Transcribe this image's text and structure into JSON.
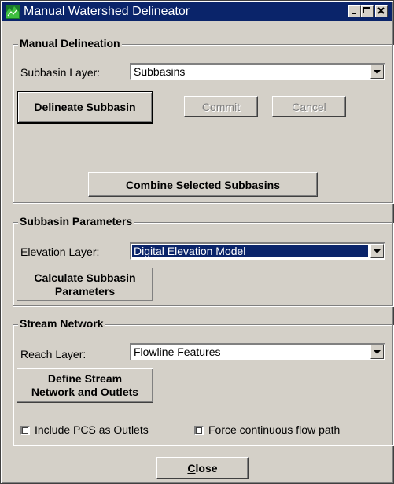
{
  "window": {
    "title": "Manual Watershed Delineator"
  },
  "manual_delineation": {
    "legend": "Manual Delineation",
    "subbasin_layer_label": "Subbasin Layer:",
    "subbasin_layer_value": "Subbasins",
    "delineate_label": "Delineate Subbasin",
    "commit_label": "Commit",
    "cancel_label": "Cancel",
    "combine_label": "Combine Selected Subbasins"
  },
  "subbasin_parameters": {
    "legend": "Subbasin Parameters",
    "elevation_label": "Elevation Layer:",
    "elevation_value": "Digital Elevation Model",
    "calc_line1": "Calculate Subbasin",
    "calc_line2": "Parameters"
  },
  "stream_network": {
    "legend": "Stream Network",
    "reach_label": "Reach Layer:",
    "reach_value": "Flowline Features",
    "define_line1": "Define Stream",
    "define_line2": "Network and Outlets",
    "include_pcs_label": "Include PCS as Outlets",
    "force_flow_label": "Force continuous flow path"
  },
  "footer": {
    "close_mnemonic": "C",
    "close_rest": "lose"
  }
}
